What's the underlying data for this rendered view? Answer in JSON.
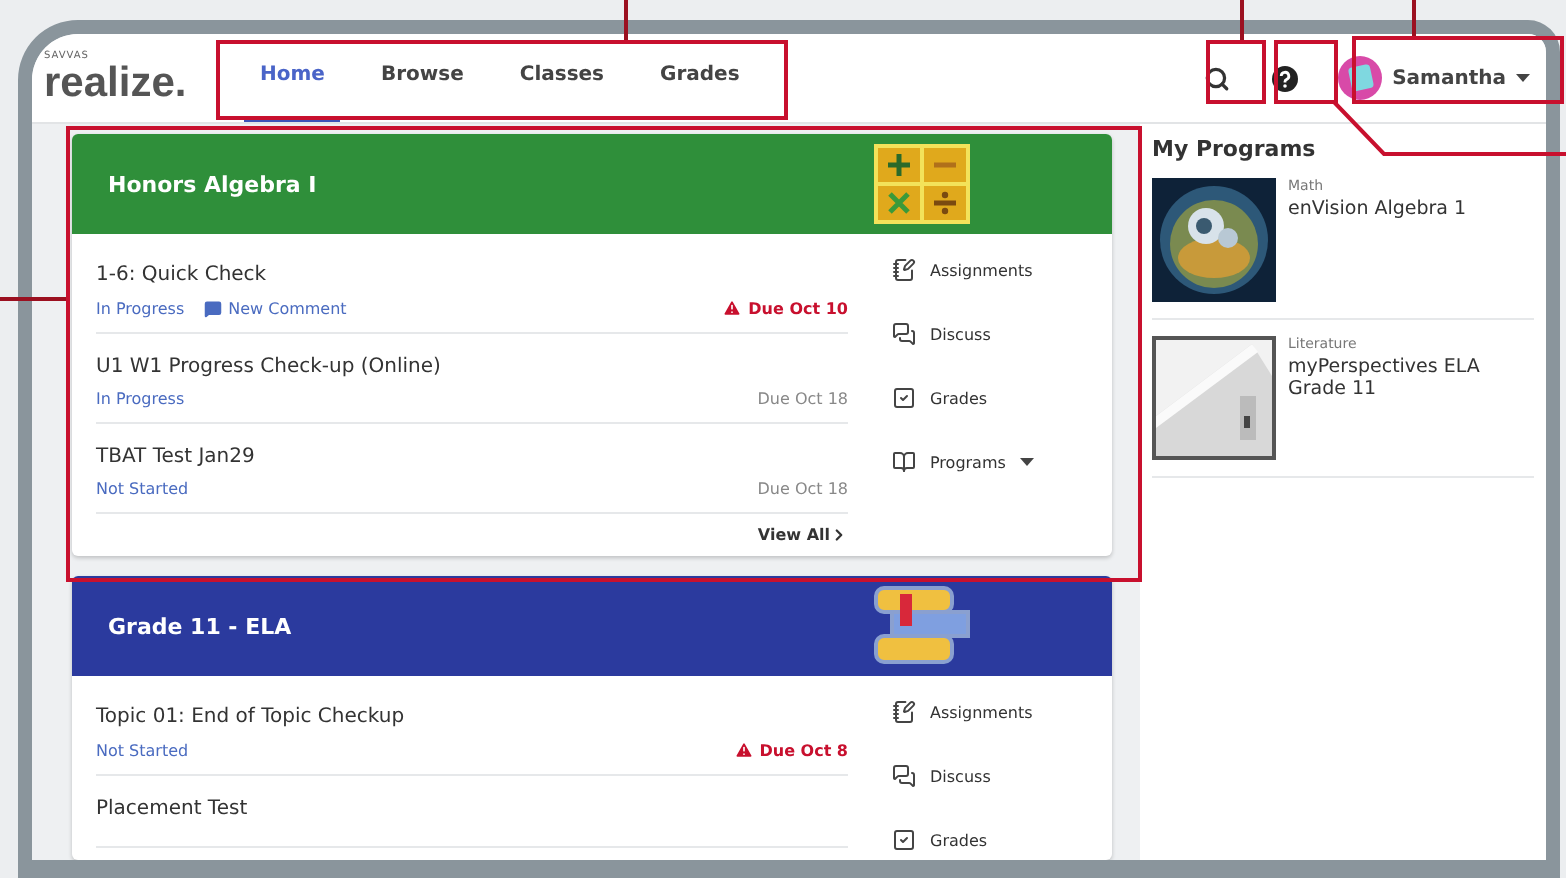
{
  "logo": {
    "brand": "SAVVAS",
    "name": "realize."
  },
  "nav": [
    {
      "label": "Home",
      "selected": true
    },
    {
      "label": "Browse",
      "selected": false
    },
    {
      "label": "Classes",
      "selected": false
    },
    {
      "label": "Grades",
      "selected": false
    }
  ],
  "user": {
    "name": "Samantha"
  },
  "classes": [
    {
      "title": "Honors Algebra I",
      "color": "#2f8f3a",
      "items": [
        {
          "title": "1-6: Quick Check",
          "status": "In Progress",
          "comment": "New Comment",
          "due": "Due Oct 10",
          "overdue": true
        },
        {
          "title": "U1 W1 Progress Check-up (Online)",
          "status": "In Progress",
          "due": "Due Oct 18",
          "overdue": false
        },
        {
          "title": "TBAT Test Jan29",
          "status": "Not Started",
          "due": "Due Oct 18",
          "overdue": false
        }
      ],
      "view_all": "View All",
      "links": [
        {
          "kind": "assignments",
          "label": "Assignments"
        },
        {
          "kind": "discuss",
          "label": "Discuss"
        },
        {
          "kind": "grades",
          "label": "Grades"
        },
        {
          "kind": "programs",
          "label": "Programs",
          "dropdown": true
        }
      ]
    },
    {
      "title": "Grade 11 - ELA",
      "color": "#2b3a9e",
      "items": [
        {
          "title": "Topic 01: End of Topic Checkup",
          "status": "Not Started",
          "due": "Due Oct 8",
          "overdue": true
        },
        {
          "title": "Placement Test"
        }
      ],
      "links": [
        {
          "kind": "assignments",
          "label": "Assignments"
        },
        {
          "kind": "discuss",
          "label": "Discuss"
        },
        {
          "kind": "grades",
          "label": "Grades"
        }
      ]
    }
  ],
  "my_programs": {
    "title": "My Programs",
    "programs": [
      {
        "subject": "Math",
        "name": "enVision Algebra 1"
      },
      {
        "subject": "Literature",
        "name": "myPerspectives ELA Grade 11"
      }
    ]
  }
}
